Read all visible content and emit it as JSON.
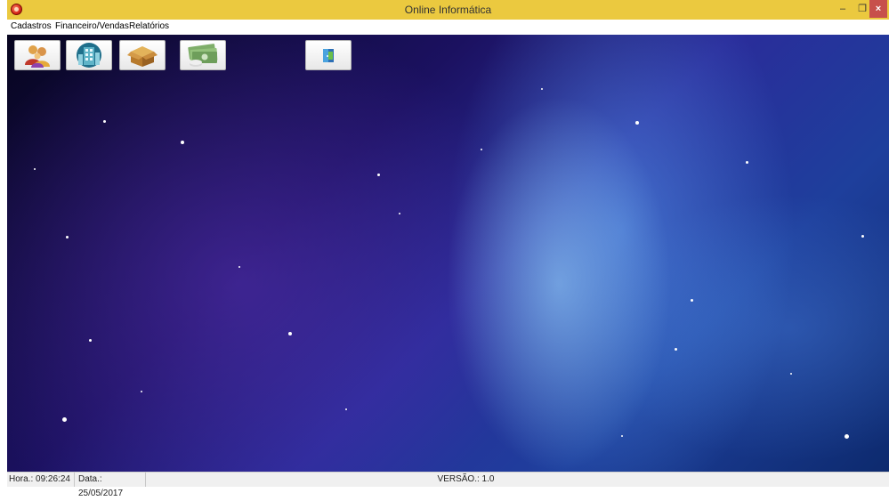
{
  "window": {
    "title": "Online Informática"
  },
  "menu": {
    "items": [
      "Cadastros",
      "Financeiro/Vendas",
      "Relatórios"
    ]
  },
  "toolbar": {
    "buttons": [
      {
        "icon": "users-icon"
      },
      {
        "icon": "building-icon"
      },
      {
        "icon": "box-icon"
      },
      {
        "icon": "money-icon"
      },
      {
        "icon": "exit-door-icon"
      }
    ]
  },
  "status": {
    "hora": "Hora.: 09:26:24",
    "data": "Data.: 25/05/2017",
    "versao": "VERSÃO.: 1.0"
  }
}
